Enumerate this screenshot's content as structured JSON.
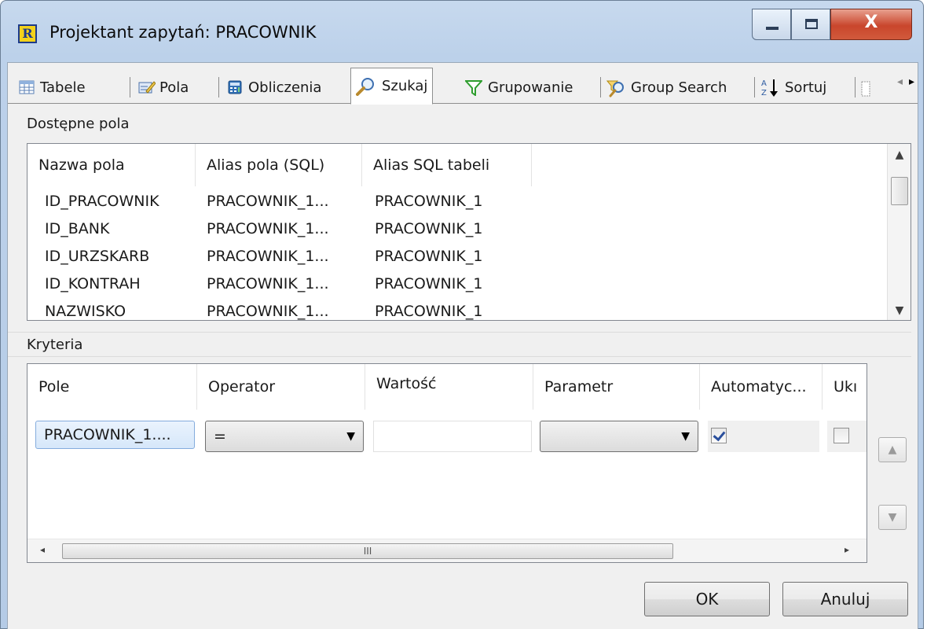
{
  "window": {
    "title": "Projektant zapytań: PRACOWNIK",
    "app_icon_letter": "R",
    "controls": {
      "minimize_icon": "minimize-icon",
      "maximize_icon": "maximize-icon",
      "close_glyph": "X"
    }
  },
  "tabs": [
    {
      "label": "Tabele",
      "icon": "table-icon"
    },
    {
      "label": "Pola",
      "icon": "fields-edit-icon"
    },
    {
      "label": "Obliczenia",
      "icon": "calculator-icon"
    },
    {
      "label": "Szukaj",
      "icon": "magnifier-icon",
      "active": true
    },
    {
      "label": "Grupowanie",
      "icon": "funnel-icon"
    },
    {
      "label": "Group Search",
      "icon": "group-search-icon"
    },
    {
      "label": "Sortuj",
      "icon": "sort-az-icon"
    }
  ],
  "tab_scroll": {
    "left": "◂",
    "right": "▸"
  },
  "available_fields": {
    "label": "Dostępne pola",
    "columns": [
      "Nazwa pola",
      "Alias pola (SQL)",
      "Alias SQL tabeli"
    ],
    "rows": [
      [
        "ID_PRACOWNIK",
        "PRACOWNIK_1...",
        "PRACOWNIK_1"
      ],
      [
        "ID_BANK",
        "PRACOWNIK_1...",
        "PRACOWNIK_1"
      ],
      [
        "ID_URZSKARB",
        "PRACOWNIK_1...",
        "PRACOWNIK_1"
      ],
      [
        "ID_KONTRAH",
        "PRACOWNIK_1...",
        "PRACOWNIK_1"
      ],
      [
        "NAZWISKO",
        "PRACOWNIK_1...",
        "PRACOWNIK_1"
      ]
    ],
    "scroll_up": "▲",
    "scroll_down": "▼"
  },
  "criteria": {
    "label": "Kryteria",
    "columns": [
      "Pole",
      "Operator",
      "Wartość",
      "Parametr",
      "Automatyc...",
      "Ukı"
    ],
    "row": {
      "field": "PRACOWNIK_1....",
      "operator": "=",
      "value": "",
      "parameter": "",
      "automatic": true,
      "hidden": false
    },
    "hscroll_grip": "III",
    "hscroll_left": "◂",
    "hscroll_right": "▸"
  },
  "move_buttons": {
    "up": "▲",
    "down": "▼"
  },
  "buttons": {
    "ok": "OK",
    "cancel": "Anuluj"
  },
  "colors": {
    "accent": "#84acdd",
    "close": "#c9462c",
    "app_icon_bg": "#f3d21b"
  }
}
